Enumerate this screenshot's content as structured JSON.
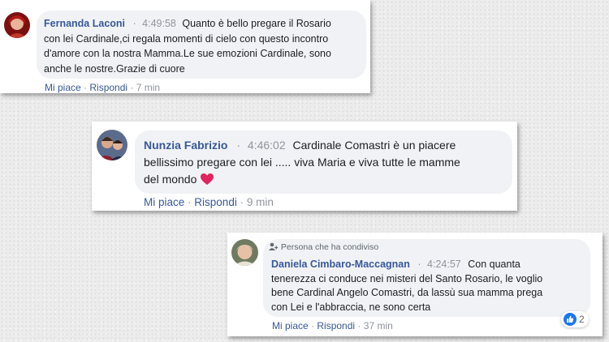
{
  "colors": {
    "name": "#385898",
    "meta": "#90949c",
    "text": "#1c1e21",
    "bubble": "#f0f2f5",
    "reaction_like": "#1877f2",
    "heart": "#e0245e"
  },
  "comments": [
    {
      "author": "Fernanda Laconi",
      "separator": "·",
      "time": "4:49:58",
      "lines": [
        "Quanto è bello pregare il Rosario",
        "con lei Cardinale,ci regala momenti di cielo con questo incontro",
        "d'amore con la nostra Mamma.Le sue emozioni Cardinale, sono",
        "anche le nostre.Grazie di cuore"
      ],
      "like_label": "Mi piace",
      "reply_label": "Rispondi",
      "ago": "7 min"
    },
    {
      "author": "Nunzia Fabrizio",
      "separator": "·",
      "time": "4:46:02",
      "lines": [
        "Cardinale Comastri è un piacere",
        "bellissimo pregare con lei ..... viva Maria e viva tutte le mamme",
        "del mondo"
      ],
      "emoji": "heart-icon",
      "like_label": "Mi piace",
      "reply_label": "Rispondi",
      "ago": "9 min"
    },
    {
      "shared_label": "Persona che ha condiviso",
      "author": "Daniela Cimbaro-Maccagnan",
      "separator": "·",
      "time": "4:24:57",
      "lines": [
        "Con quanta",
        "tenerezza ci conduce nei misteri del Santo Rosario, le voglio",
        "bene Cardinal Angelo Comastri, da lassù sua mamma prega",
        "con Lei e l'abbraccia, ne sono certa"
      ],
      "like_label": "Mi piace",
      "reply_label": "Rispondi",
      "ago": "37 min",
      "reaction_count": "2"
    }
  ]
}
